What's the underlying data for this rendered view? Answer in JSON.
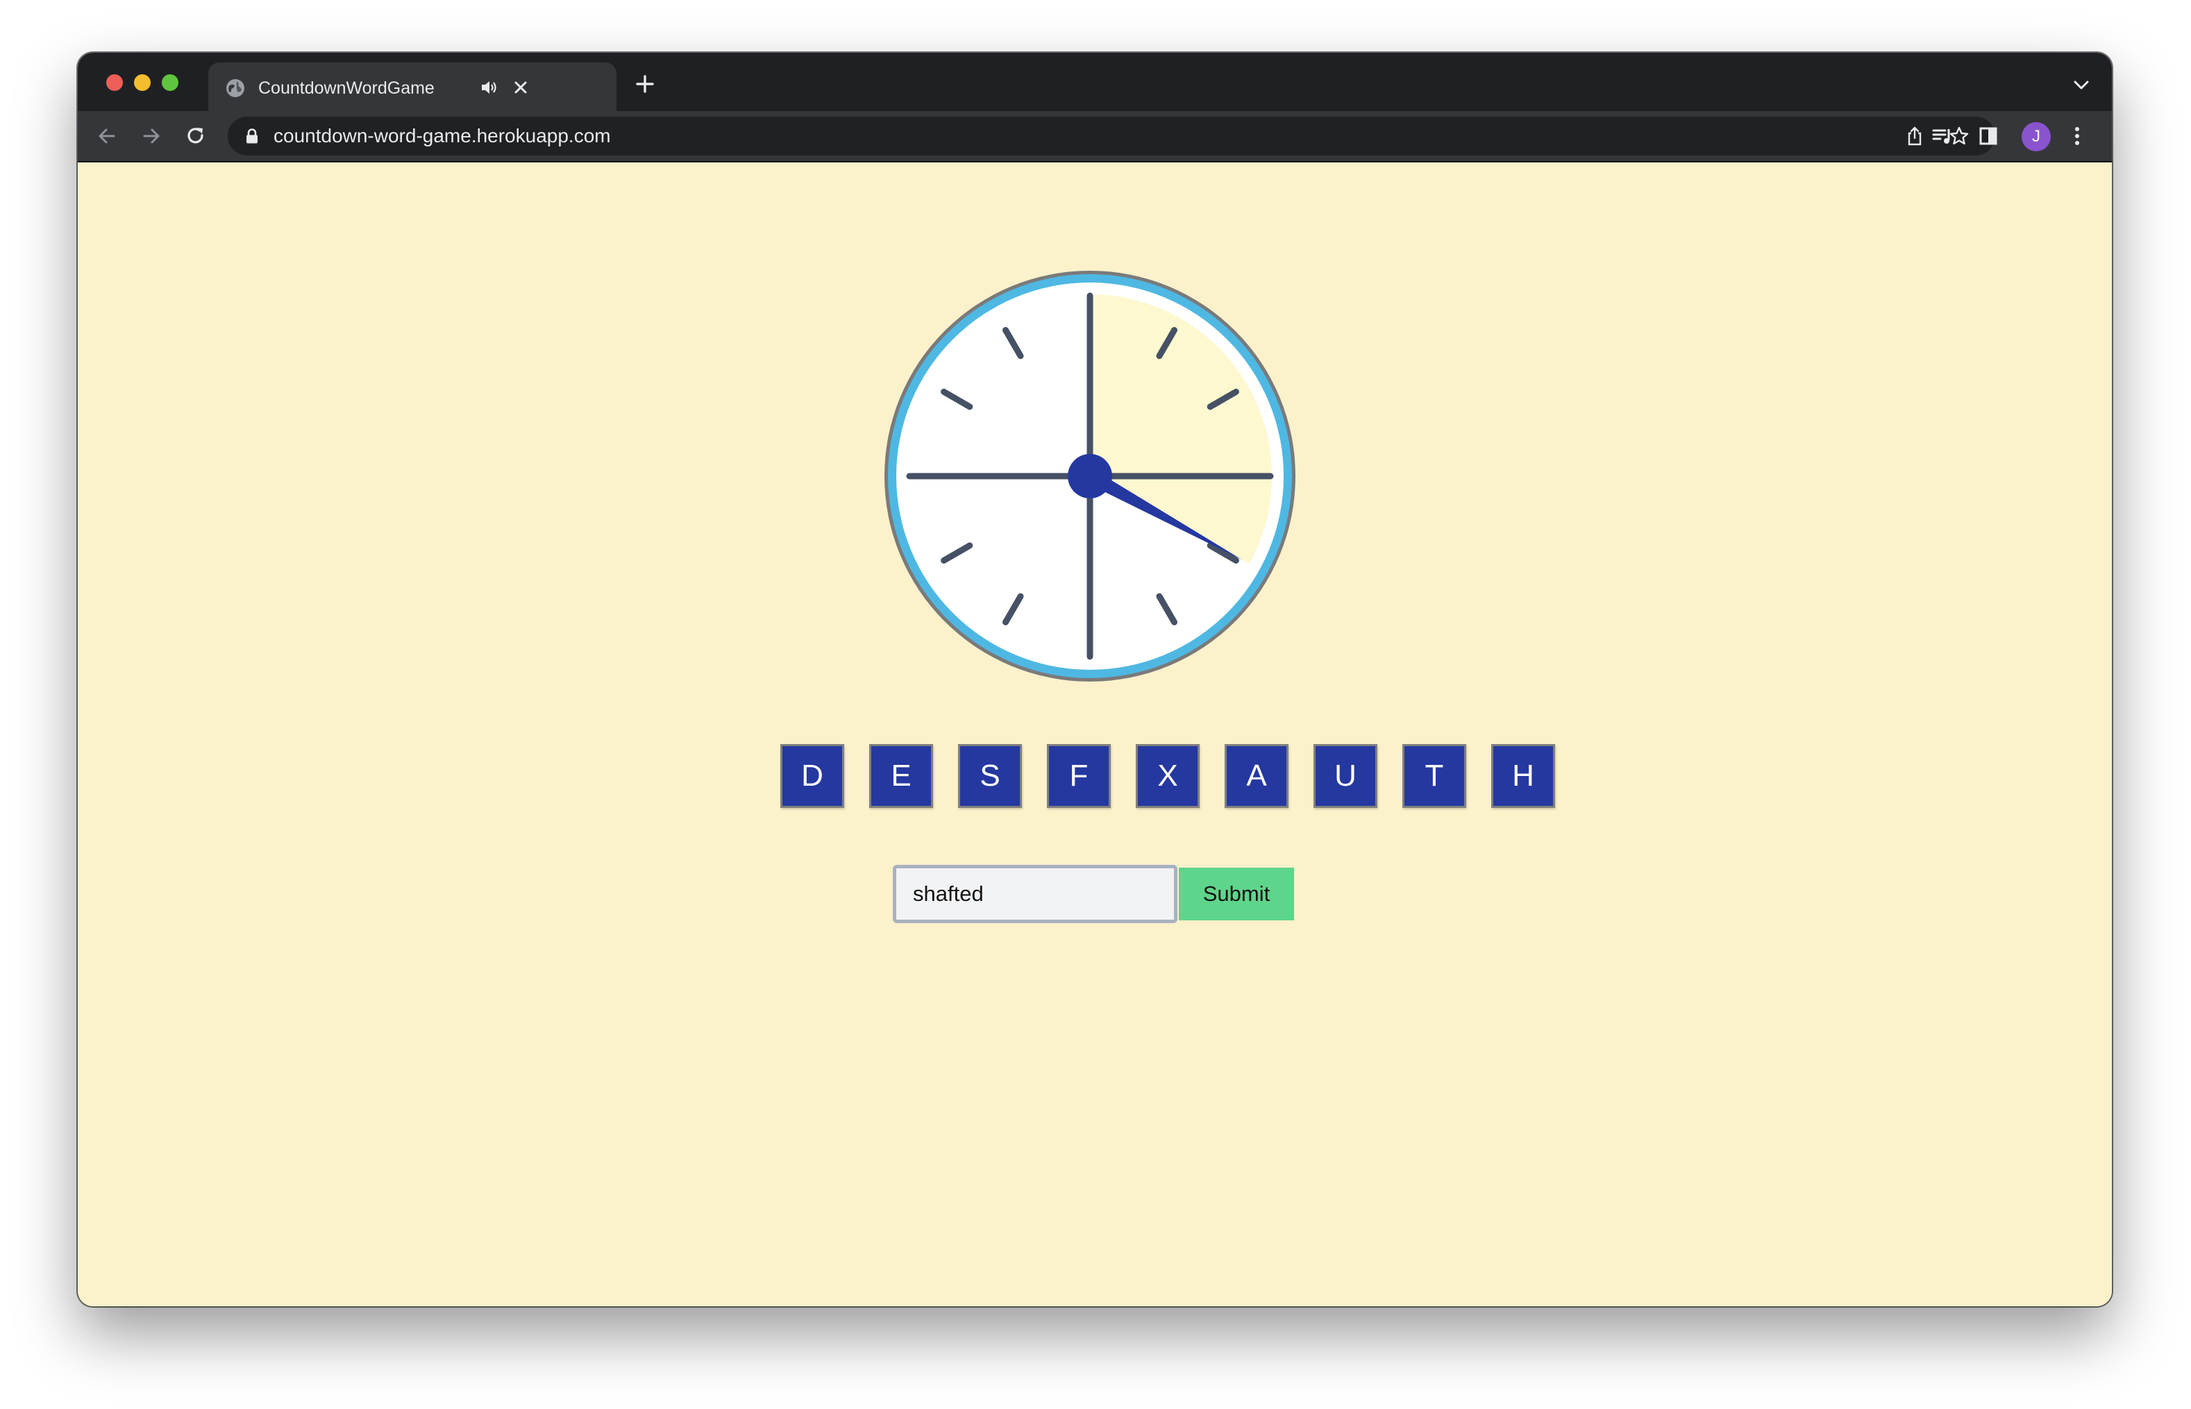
{
  "browser": {
    "tab_title": "CountdownWordGame",
    "url": "countdown-word-game.herokuapp.com",
    "profile_initial": "J",
    "icons": [
      "back-arrow-icon",
      "forward-arrow-icon",
      "reload-icon",
      "lock-icon",
      "share-icon",
      "star-icon",
      "media-control-icon",
      "side-panel-icon",
      "kebab-menu-icon",
      "tab-search-chevron-icon",
      "audio-playing-icon",
      "close-icon",
      "plus-icon",
      "globe-icon"
    ]
  },
  "game": {
    "clock": {
      "elapsed_fraction": 0.33,
      "colors": {
        "rim_outer": "#7a7a7a",
        "rim_inner": "#4eb8e3",
        "face": "#ffffff",
        "elapsed": "#fdf8cf",
        "ticks": "#465166",
        "hand": "#2438a0"
      }
    },
    "letters": [
      "D",
      "E",
      "S",
      "F",
      "X",
      "A",
      "U",
      "T",
      "H"
    ],
    "answer_value": "shafted",
    "submit_label": "Submit",
    "colors": {
      "page_background": "#fbf1cb",
      "tile": "#2438a0",
      "submit": "#5fd58b"
    }
  }
}
